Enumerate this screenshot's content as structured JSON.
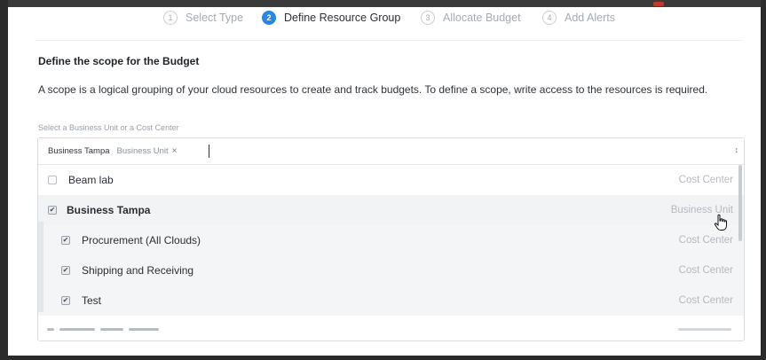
{
  "stepper": {
    "steps": [
      {
        "number": "1",
        "label": "Select Type",
        "state": "done"
      },
      {
        "number": "2",
        "label": "Define Resource Group",
        "state": "active"
      },
      {
        "number": "3",
        "label": "Allocate Budget",
        "state": "upcoming"
      },
      {
        "number": "4",
        "label": "Add Alerts",
        "state": "upcoming"
      }
    ]
  },
  "scope": {
    "title": "Define the scope for the Budget",
    "description": "A scope is a logical grouping of your cloud resources to create and track budgets. To define a scope, write access to the resources is required.",
    "select_hint": "Select a Business Unit or a Cost Center"
  },
  "selector": {
    "selected_tag": {
      "name": "Business Tampa",
      "type": "Business Unit",
      "remove_glyph": "×"
    },
    "toggle_glyph": "↕",
    "options": [
      {
        "label": "Beam lab",
        "type": "Cost Center",
        "checked": false
      },
      {
        "label": "Business Tampa",
        "type": "Business Unit",
        "checked": true
      },
      {
        "label": "Procurement (All Clouds)",
        "type": "Cost Center",
        "checked": true
      },
      {
        "label": "Shipping and Receiving",
        "type": "Cost Center",
        "checked": true
      },
      {
        "label": "Test",
        "type": "Cost Center",
        "checked": true
      }
    ]
  },
  "icons": {
    "checkbox_checked": "check-icon",
    "cursor": "hand-pointer-icon"
  },
  "colors": {
    "accent": "#2a86e0",
    "muted_text": "#b4b9c0"
  }
}
